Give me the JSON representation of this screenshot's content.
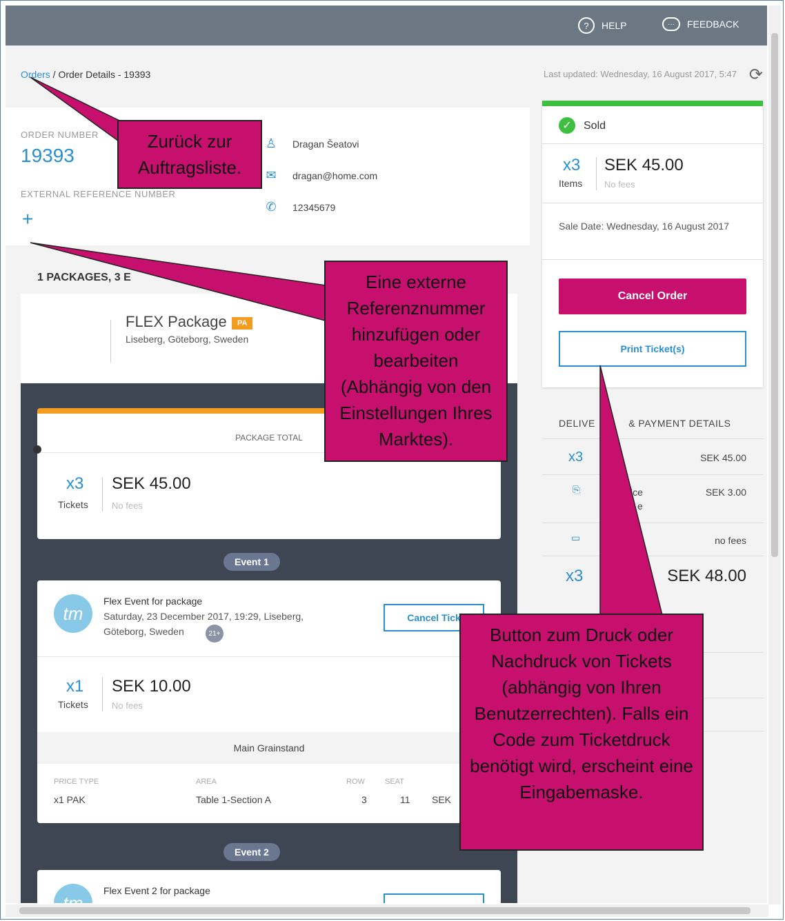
{
  "topbar": {
    "help": "HELP",
    "feedback": "FEEDBACK"
  },
  "breadcrumb": {
    "orders": "Orders",
    "separator": " / ",
    "current": "Order Details - 19393"
  },
  "last_updated": "Last updated: Wednesday, 16 August 2017, 5:47",
  "order": {
    "number_label": "ORDER NUMBER",
    "number": "19393",
    "external_ref_label": "EXTERNAL REFERENCE NUMBER",
    "add_symbol": "+",
    "name": "Dragan Šeatovi",
    "email": "dragan@home.com",
    "phone": "12345679"
  },
  "packages_summary": "1 PACKAGES, 3 E",
  "package": {
    "name": "FLEX Package",
    "badge": "PA",
    "location": "Liseberg, Göteborg, Sweden",
    "total_label": "PACKAGE TOTAL",
    "qty": "x3",
    "qty_label": "Tickets",
    "price": "SEK 45.00",
    "fees": "No fees"
  },
  "events": [
    {
      "pill": "Event 1",
      "logo": "tm",
      "title": "Flex Event for package",
      "date": "Saturday, 23 December 2017, 19:29, Liseberg,",
      "place": "Göteborg, Sweden",
      "age": "21+",
      "cancel_label": "Cancel Tick",
      "qty": "x1",
      "qty_label": "Tickets",
      "price": "SEK 10.00",
      "fees": "No fees",
      "section": "Main Grainstand",
      "table_headers": {
        "price_type": "PRICE TYPE",
        "area": "AREA",
        "row": "ROW",
        "seat": "SEAT"
      },
      "row": {
        "price_type": "x1 PAK",
        "area": "Table 1-Section A",
        "row": "3",
        "seat": "11",
        "price": "SEK"
      }
    },
    {
      "pill": "Event 2",
      "logo": "tm",
      "title": "Flex Event 2 for package"
    }
  ],
  "summary": {
    "status": "Sold",
    "qty": "x3",
    "qty_label": "Items",
    "price": "SEK 45.00",
    "fees": "No fees",
    "sale_date_label": "Sale Date:",
    "sale_date": "Wednesday, 16 August 2017",
    "cancel_label": "Cancel Order",
    "print_label": "Print Ticket(s)"
  },
  "delivery": {
    "heading_a": "DELIVE",
    "heading_b": "& PAYMENT DETAILS",
    "rows": [
      {
        "qty": "x3",
        "value": "SEK 45.00"
      },
      {
        "label_a": "ice",
        "label_b": "e",
        "value": "SEK 3.00"
      },
      {
        "value": "no fees"
      }
    ],
    "total_qty": "x3",
    "total_value": "SEK 48.00"
  },
  "callouts": {
    "back": "Zurück zur Auftragsliste.",
    "external": "Eine externe Referenznummer hinzufügen oder bearbeiten (Abhängig von den Einstellungen Ihres Marktes).",
    "print": "Button zum Druck oder Nachdruck von Tickets (abhängig von Ihren Benutzerrechten). Falls ein Code zum Ticketdruck benötigt wird, erscheint eine Eingabemaske."
  },
  "colors": {
    "accent": "#2a8fd0",
    "brand": "#c7106e",
    "status_ok": "#3fbf3f",
    "package_orange": "#f39c1f",
    "topbar": "#6b7884"
  }
}
